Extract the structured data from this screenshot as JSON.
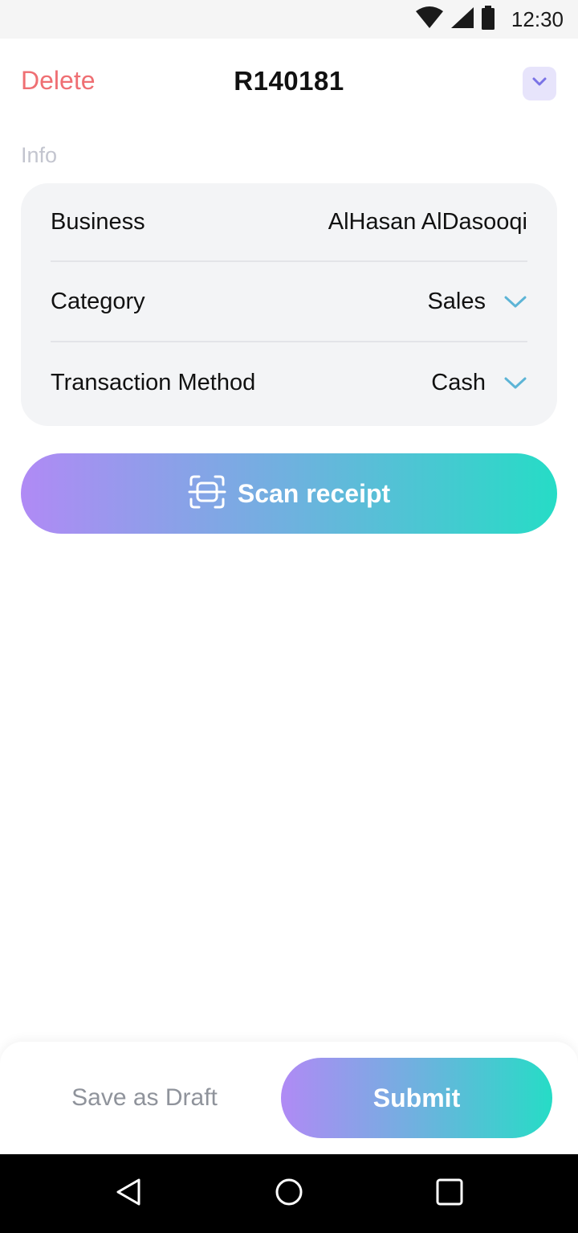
{
  "status_bar": {
    "time": "12:30",
    "icons": [
      "wifi-icon",
      "cellular-signal-icon",
      "battery-icon"
    ]
  },
  "header": {
    "delete_label": "Delete",
    "title": "R140181",
    "more_icon": "chevron-down-icon"
  },
  "info": {
    "section_label": "Info",
    "rows": [
      {
        "label": "Business",
        "value": "AlHasan AlDasooqi",
        "has_dropdown": false
      },
      {
        "label": "Category",
        "value": "Sales",
        "has_dropdown": true
      },
      {
        "label": "Transaction Method",
        "value": "Cash",
        "has_dropdown": true
      }
    ]
  },
  "scan": {
    "label": "Scan receipt",
    "icon": "scan-icon"
  },
  "actions": {
    "draft_label": "Save as Draft",
    "submit_label": "Submit"
  },
  "nav": {
    "buttons": [
      "back-icon",
      "home-icon",
      "recents-icon"
    ]
  },
  "colors": {
    "delete": "#ef6f73",
    "accent_chevron": "#5cb4d6",
    "gradient_start": "#b08af5",
    "gradient_end": "#26dcc6"
  }
}
